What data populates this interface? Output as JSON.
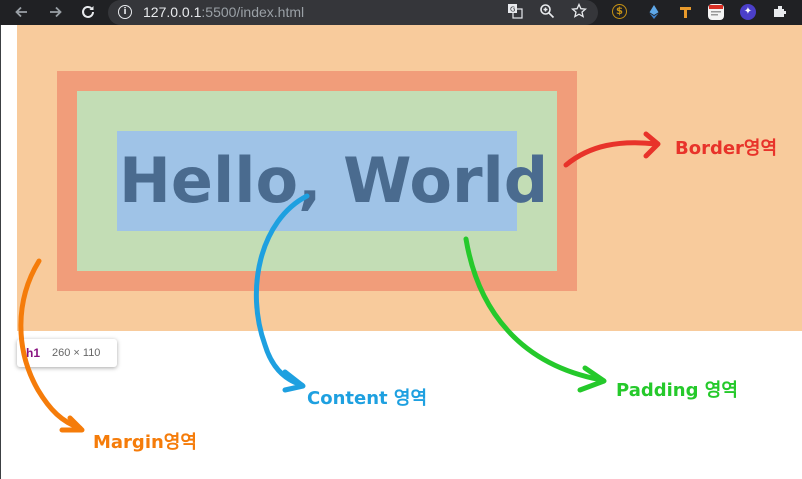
{
  "browser": {
    "url_host": "127.0.0.1",
    "url_path": ":5500/index.html",
    "icons": {
      "back": "arrow-left-icon",
      "forward": "arrow-right-icon",
      "reload": "reload-icon",
      "info": "info-icon",
      "translate": "translate-icon",
      "zoom": "zoom-icon",
      "bookmark": "star-icon"
    }
  },
  "page": {
    "heading": "Hello, World",
    "colors": {
      "margin": "#f8cb9c",
      "border": "#f19d7a",
      "padding": "#c3ddb5",
      "content": "#9fc3e7"
    }
  },
  "devtools_tooltip": {
    "tag": "h1",
    "dimensions": "260 × 110"
  },
  "annotations": {
    "border": {
      "text": "Border영역",
      "color": "#e8332a"
    },
    "content": {
      "text": "Content 영역",
      "color": "#1ea0e0"
    },
    "padding": {
      "text": "Padding 영역",
      "color": "#25c92b"
    },
    "margin": {
      "text": "Margin영역",
      "color": "#f57c0a"
    }
  }
}
